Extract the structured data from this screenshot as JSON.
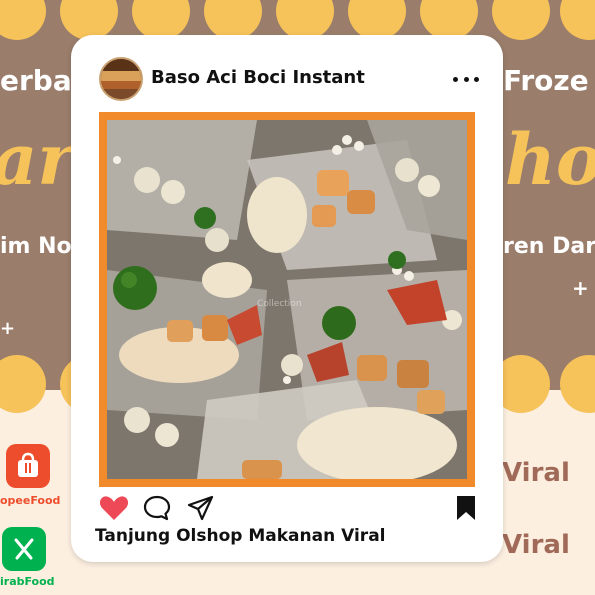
{
  "post": {
    "username": "Baso Aci Boci Instant",
    "caption": "Tanjung Olshop Makanan Viral",
    "liked": true,
    "watermark": "Collection"
  },
  "icons": {
    "like": "heart-icon",
    "comment": "comment-icon",
    "share": "send-icon",
    "save": "bookmark-icon",
    "more": "more-icon"
  },
  "background": {
    "left_line1": "erba",
    "left_line2": "im No",
    "right_line1": "Froze",
    "right_line2": "ren Dar",
    "big_left": "ar",
    "big_right": "ho",
    "viral_1": "Viral",
    "viral_2": "Viral",
    "plus": "+",
    "apps": [
      {
        "name": "ShopeeFood",
        "label": "opeeFood",
        "color": "#ee4d2d"
      },
      {
        "name": "GrabFood",
        "label": "irabFood",
        "color": "#00b14f"
      }
    ]
  },
  "colors": {
    "poster_brown": "#9a7d6b",
    "poster_yellow": "#f6c25a",
    "poster_cream": "#fcefe0",
    "photo_border": "#f08a2a",
    "like_red": "#ed4956"
  }
}
